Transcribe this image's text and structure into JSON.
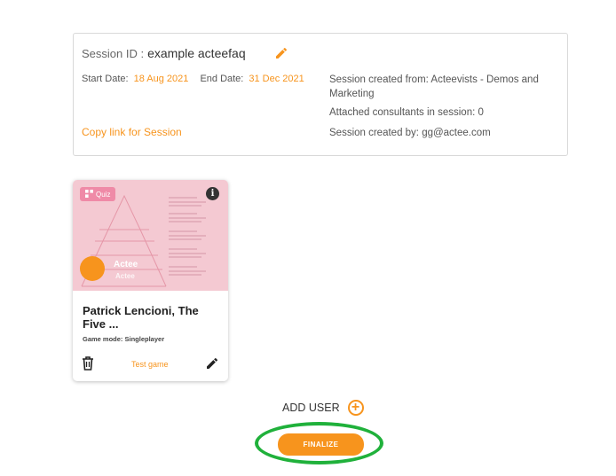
{
  "session": {
    "id_label": "Session ID :",
    "id_value": "example acteefaq",
    "start_label": "Start Date:",
    "start_value": "18 Aug 2021",
    "end_label": "End Date:",
    "end_value": "31 Dec 2021",
    "created_from": "Session created from: Acteevists - Demos and Marketing",
    "attached": "Attached consultants in session: 0",
    "created_by": "Session created by: gg@actee.com",
    "copy_link": "Copy link for Session"
  },
  "game_card": {
    "badge": "Quiz",
    "logo_text": "Actee",
    "logo_text2": "Actee",
    "title": "Patrick Lencioni, The Five ...",
    "mode": "Game mode: Singleplayer",
    "test_label": "Test game"
  },
  "actions": {
    "add_user": "ADD USER",
    "finalize": "FINALIZE"
  },
  "colors": {
    "accent": "#f7941d",
    "thumb_bg": "#f4c9d2",
    "highlight_ring": "#20b13b"
  },
  "icons": [
    "edit-icon",
    "info-icon",
    "trash-icon",
    "plus-circle-icon",
    "quiz-icon"
  ]
}
